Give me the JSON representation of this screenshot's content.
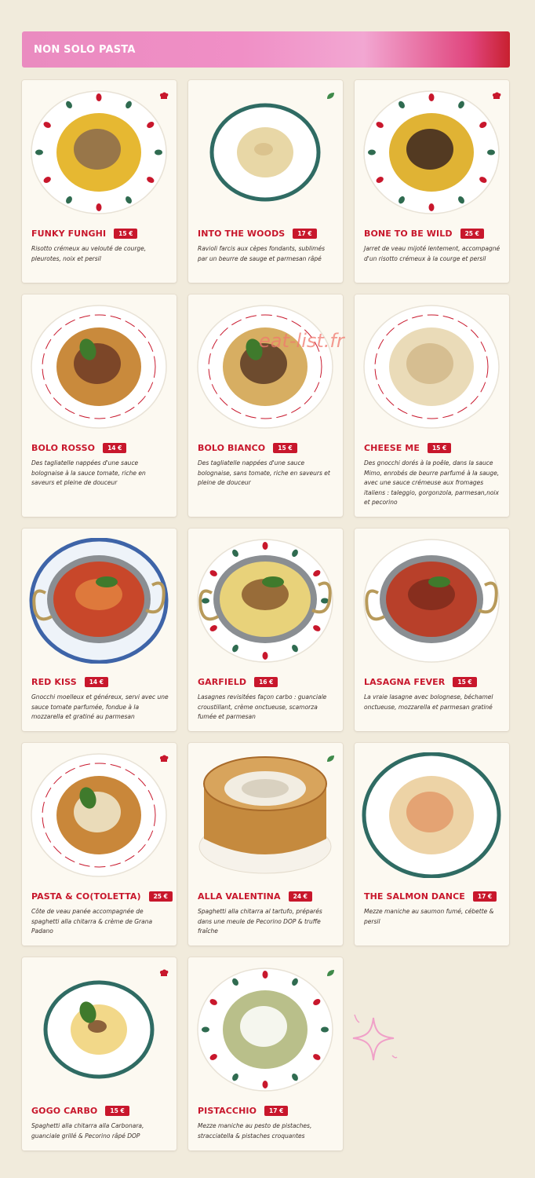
{
  "section": {
    "title": "NON SOLO PASTA"
  },
  "watermark": "eat-list.fr",
  "colors": {
    "accent": "#c8172c",
    "card_bg": "#fcf9f1",
    "page_bg": "#f1ebdc"
  },
  "dishes": [
    {
      "name": "FUNKY FUNGHI",
      "price": "15 €",
      "description": "Risotto crémeux au velouté de courge, pleurotes, noix et persil",
      "badge": "chef-hat-icon",
      "image": "risotto-mushrooms"
    },
    {
      "name": "INTO THE WOODS",
      "price": "17 €",
      "description": "Ravioli farcis aux cèpes fondants, sublimés par un beurre de sauge et parmesan râpé",
      "badge": "leaf-icon",
      "image": "ravioli"
    },
    {
      "name": "BONE TO BE WILD",
      "price": "25 €",
      "description": "Jarret de veau mijoté lentement, accompagné d'un risotto crémeux à la courge et persil",
      "badge": "chef-hat-icon",
      "image": "osso-buco"
    },
    {
      "name": "BOLO ROSSO",
      "price": "14 €",
      "description": "Des tagliatelle nappées d'une sauce bolognaise à la sauce tomate, riche en saveurs et pleine de douceur",
      "badge": "",
      "image": "tagliatelle-rosso"
    },
    {
      "name": "BOLO BIANCO",
      "price": "15 €",
      "description": "Des tagliatelle nappées d'une sauce bolognaise, sans tomate, riche en saveurs et pleine de douceur",
      "badge": "",
      "image": "tagliatelle-bianco"
    },
    {
      "name": "CHEESE ME",
      "price": "15 €",
      "description": "Des gnocchi dorés à la poêle, dans la sauce Mimo, enrobés de beurre parfumé à la sauge, avec une sauce crémeuse aux fromages italiens : taleggio, gorgonzola, parmesan,noix et pecorino",
      "badge": "",
      "image": "gnocchi-cheese"
    },
    {
      "name": "RED KISS",
      "price": "14 €",
      "description": "Gnocchi moelleux et généreux, servi avec une sauce tomate parfumée, fondue à la mozzarella et gratiné au parmesan",
      "badge": "",
      "image": "gnocchi-tomato"
    },
    {
      "name": "GARFIELD",
      "price": "16 €",
      "description": "Lasagnes revisitées façon carbo : guanciale croustillant, crème onctueuse, scamorza fumée et parmesan",
      "badge": "",
      "image": "lasagna-carbo"
    },
    {
      "name": "LASAGNA FEVER",
      "price": "15 €",
      "description": "La vraie lasagne avec bolognese, béchamel onctueuse, mozzarella et parmesan gratiné",
      "badge": "",
      "image": "lasagna"
    },
    {
      "name": "PASTA & CO(TOLETTA)",
      "price": "25 €",
      "description": "Côte de veau panée accompagnée de spaghetti alla chitarra & crème de Grana Padano",
      "badge": "chef-hat-icon",
      "image": "cotoletta"
    },
    {
      "name": "ALLA VALENTINA",
      "price": "24 €",
      "description": "Spaghetti alla chitarra al tartufo, préparés dans une meule de Pecorino DOP & truffe fraîche",
      "badge": "leaf-icon",
      "image": "cheese-wheel"
    },
    {
      "name": "THE SALMON DANCE",
      "price": "17 €",
      "description": "Mezze maniche au saumon fumé, cébette & persil",
      "badge": "",
      "image": "salmon-pasta"
    },
    {
      "name": "GOGO CARBO",
      "price": "15 €",
      "description": "Spaghetti alla chitarra alla Carbonara, guanciale grillé & Pecorino râpé DOP",
      "badge": "chef-hat-icon",
      "image": "carbonara"
    },
    {
      "name": "PISTACCHIO",
      "price": "17 €",
      "description": "Mezze maniche au pesto de pistaches, stracciatella & pistaches croquantes",
      "badge": "leaf-icon",
      "image": "pistachio-pasta"
    }
  ]
}
